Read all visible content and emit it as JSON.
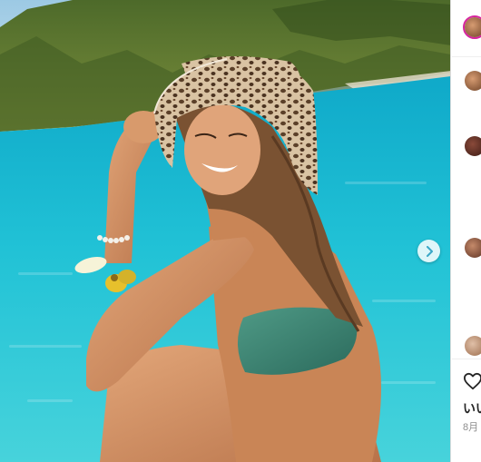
{
  "post": {
    "likes_label": "いい",
    "date_label": "8月"
  },
  "icons": {
    "next": "chevron-right-icon",
    "like": "heart-icon"
  },
  "colors": {
    "sea": "#19b6cf",
    "accent_ring": "#d6249f",
    "next_arrow": "#3aa7c7"
  }
}
